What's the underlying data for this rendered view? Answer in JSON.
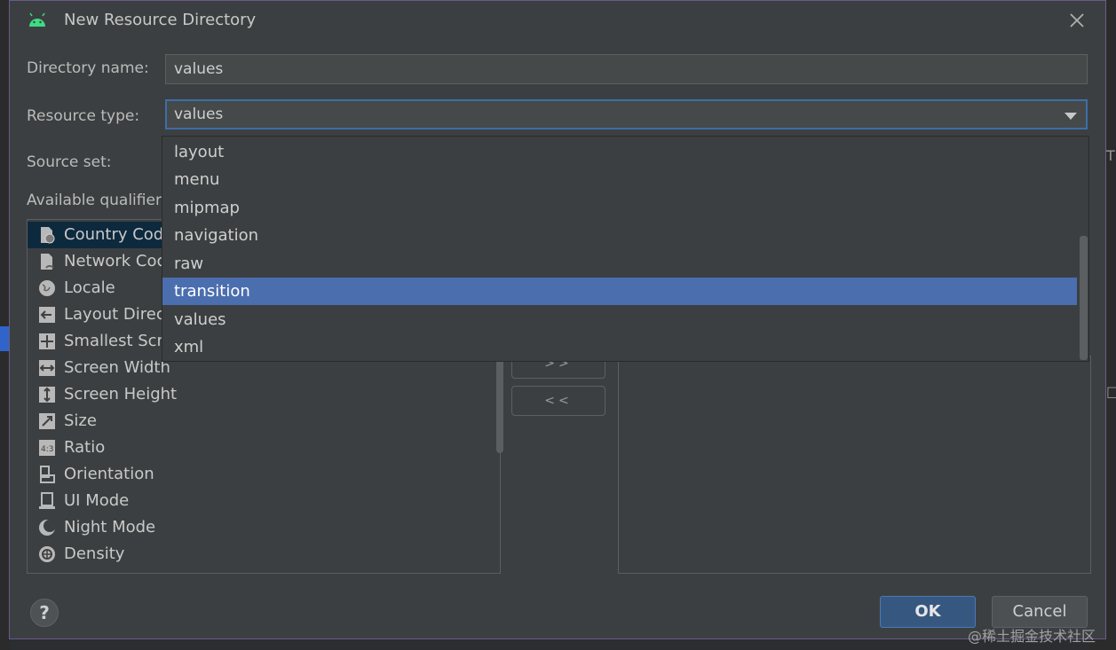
{
  "dialog": {
    "title": "New Resource Directory",
    "close_icon": "close-icon",
    "app_icon": "android-icon"
  },
  "form": {
    "directory_name_label": "Directory name:",
    "directory_name_value": "values",
    "resource_type_label": "Resource type:",
    "resource_type_value": "values",
    "source_set_label": "Source set:",
    "available_qualifiers_label": "Available qualifier"
  },
  "dropdown": {
    "options": [
      "layout",
      "menu",
      "mipmap",
      "navigation",
      "raw",
      "transition",
      "values",
      "xml"
    ],
    "highlighted": "transition"
  },
  "qualifiers": [
    {
      "label": "Country Cod",
      "icon": "country-code-icon",
      "selected": true
    },
    {
      "label": "Network Coc",
      "icon": "network-code-icon",
      "selected": false
    },
    {
      "label": "Locale",
      "icon": "globe-icon",
      "selected": false
    },
    {
      "label": "Layout Direc",
      "icon": "layout-direction-icon",
      "selected": false
    },
    {
      "label": "Smallest Scre",
      "icon": "smallest-screen-icon",
      "selected": false
    },
    {
      "label": "Screen Width",
      "icon": "screen-width-icon",
      "selected": false
    },
    {
      "label": "Screen Height",
      "icon": "screen-height-icon",
      "selected": false
    },
    {
      "label": "Size",
      "icon": "size-icon",
      "selected": false
    },
    {
      "label": "Ratio",
      "icon": "ratio-icon",
      "selected": false
    },
    {
      "label": "Orientation",
      "icon": "orientation-icon",
      "selected": false
    },
    {
      "label": "UI Mode",
      "icon": "ui-mode-icon",
      "selected": false
    },
    {
      "label": "Night Mode",
      "icon": "night-mode-icon",
      "selected": false
    },
    {
      "label": "Density",
      "icon": "density-icon",
      "selected": false
    }
  ],
  "buttons": {
    "add": ">>",
    "remove": "<<",
    "ok": "OK",
    "cancel": "Cancel",
    "help": "?"
  },
  "watermark": "@稀土掘金技术社区",
  "colors": {
    "accent": "#4b6eaf",
    "dialog_bg": "#3c3f41",
    "ok_bg": "#365880"
  }
}
